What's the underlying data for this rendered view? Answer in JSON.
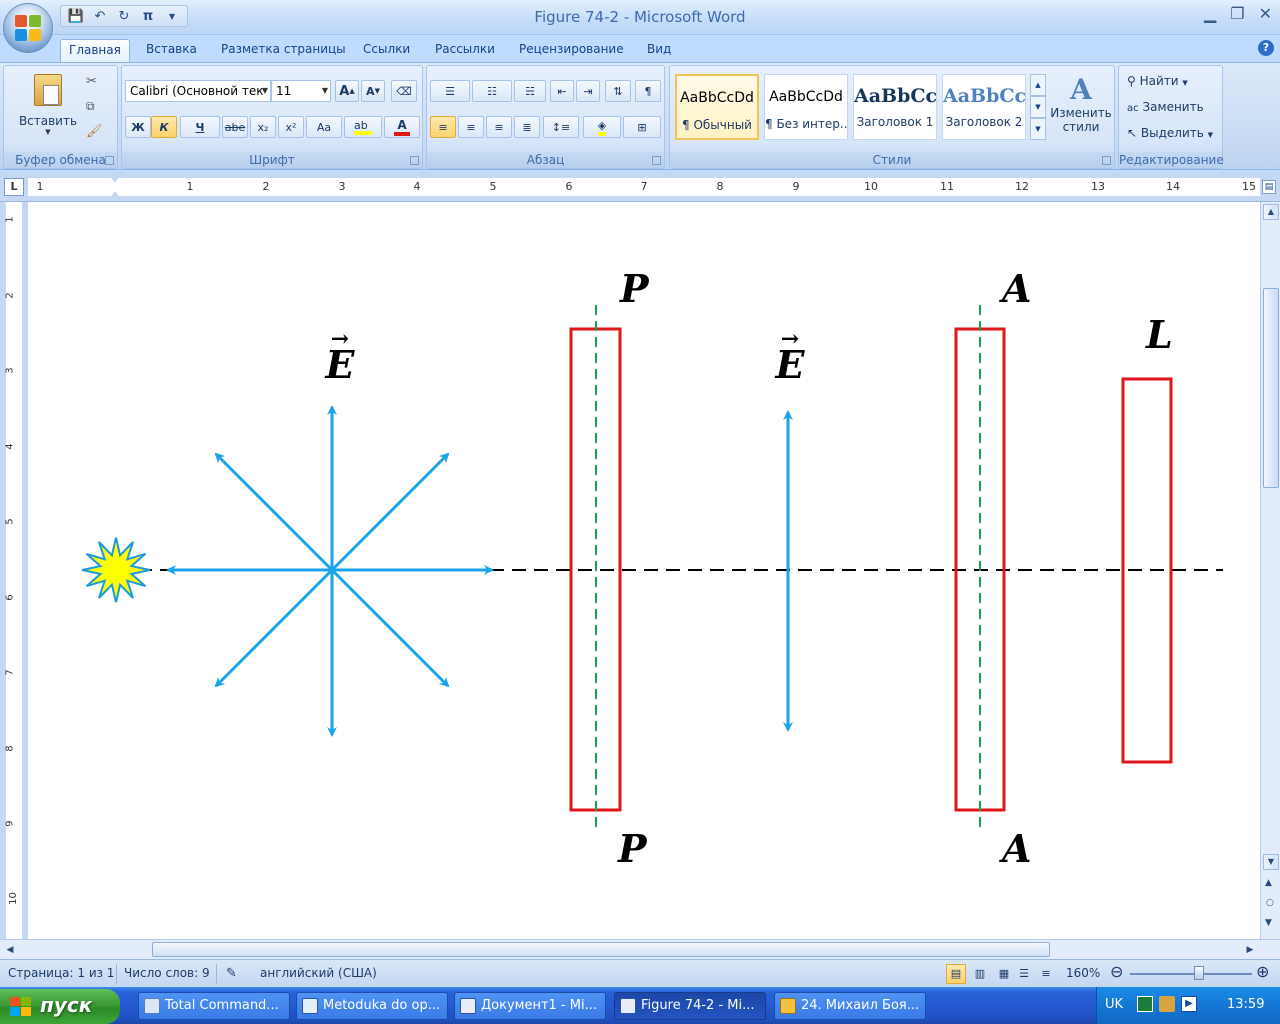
{
  "window": {
    "title": "Figure 74-2 - Microsoft Word"
  },
  "qat": {
    "save": "💾",
    "undo": "↶",
    "redo": "↻",
    "pi": "π"
  },
  "tabs": [
    "Главная",
    "Вставка",
    "Разметка страницы",
    "Ссылки",
    "Рассылки",
    "Рецензирование",
    "Вид"
  ],
  "ribbon": {
    "clipboard": {
      "paste_label": "Вставить",
      "group_label": "Буфер обмена"
    },
    "font": {
      "family": "Calibri (Основной тек",
      "size": "11",
      "grow": "A",
      "shrink": "A",
      "bold": "Ж",
      "italic": "К",
      "underline": "Ч",
      "strike": "abe",
      "subscript": "x₂",
      "superscript": "x²",
      "case": "Aa",
      "group_label": "Шрифт"
    },
    "paragraph": {
      "group_label": "Абзац"
    },
    "styles": {
      "tiles": [
        {
          "sample": "AaBbCcDd",
          "name": "¶ Обычный"
        },
        {
          "sample": "AaBbCcDd",
          "name": "¶ Без интер..."
        },
        {
          "sample": "AaBbCc",
          "name": "Заголовок 1"
        },
        {
          "sample": "AaBbCc",
          "name": "Заголовок 2"
        }
      ],
      "change_label_1": "Изменить",
      "change_label_2": "стили",
      "group_label": "Стили"
    },
    "editing": {
      "find": "Найти",
      "replace": "Заменить",
      "select": "Выделить",
      "group_label": "Редактирование"
    }
  },
  "ruler": {
    "corner": "L",
    "h_numbers": [
      "1",
      "1",
      "2",
      "3",
      "4",
      "5",
      "6",
      "7",
      "8",
      "9",
      "10",
      "11",
      "12",
      "13",
      "14",
      "15"
    ],
    "v_numbers": [
      "1",
      "2",
      "3",
      "4",
      "5",
      "6",
      "7",
      "8",
      "9",
      "10"
    ]
  },
  "figure": {
    "label_P_top": "P",
    "label_P_bottom": "P",
    "label_A_top": "A",
    "label_A_bottom": "A",
    "label_L": "L",
    "vector_E_1": "E",
    "vector_E_2": "E",
    "vector_arrow": "→",
    "colors": {
      "rays": "#1aa3e8",
      "plates": "#e0161b",
      "axis_dash": "#1aa34a",
      "source_fill": "#ffff00",
      "source_stroke": "#1a9be0"
    }
  },
  "status": {
    "page": "Страница: 1 из 1",
    "words": "Число слов: 9",
    "language": "английский (США)",
    "zoom": "160%",
    "zoom_level_percent": 160
  },
  "taskbar": {
    "start": "пуск",
    "tasks": [
      {
        "label": "Total Command...",
        "active": false
      },
      {
        "label": "Metoduka do op...",
        "active": false
      },
      {
        "label": "Документ1 - Mi...",
        "active": false
      },
      {
        "label": "Figure 74-2 - Mi...",
        "active": true
      },
      {
        "label": "24. Михаил Боя...",
        "active": false
      }
    ],
    "lang": "UK",
    "clock": "13:59"
  }
}
